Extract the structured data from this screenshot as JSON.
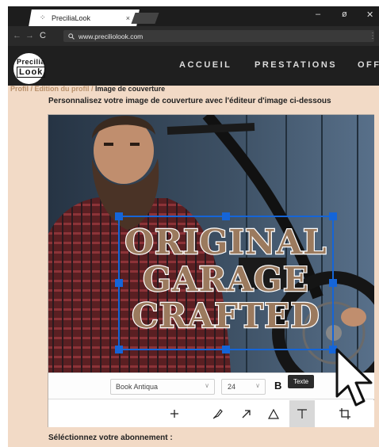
{
  "browser": {
    "tab_title": "PreciliaLook",
    "tab_close": "×",
    "url": "www.preciliolook.com",
    "minimize": "–",
    "maximize": "ø",
    "close": "✕"
  },
  "site": {
    "logo_top": "Precilia",
    "logo_bottom": "Look",
    "nav": [
      "ACCUEIL",
      "PRESTATIONS",
      "OFF"
    ]
  },
  "breadcrumb": {
    "items": [
      "Profil",
      "Edition du profil"
    ],
    "separator": " / ",
    "current": "Image de couverture"
  },
  "instruction": "Personnalisez votre image de couverture avec l'éditeur d'image ci-dessous",
  "editor": {
    "overlay_lines": [
      "ORIGINAL",
      "GARAGE",
      "CRAFTED"
    ],
    "font_family": "Book Antiqua",
    "font_size": "24",
    "bold_label": "B",
    "tooltip": "Texte",
    "tools": [
      "add-icon",
      "brush-icon",
      "arrow-icon",
      "triangle-icon",
      "text-icon",
      "crop-icon"
    ],
    "active_tool": "text-icon"
  },
  "subscribe_label": "Séléctionnez votre abonnement :",
  "colors": {
    "accent_handles": "#1565d8",
    "text_overlay": "#9b7a5e",
    "page_bg": "#f2dac6",
    "breadcrumb": "#b9906a"
  }
}
